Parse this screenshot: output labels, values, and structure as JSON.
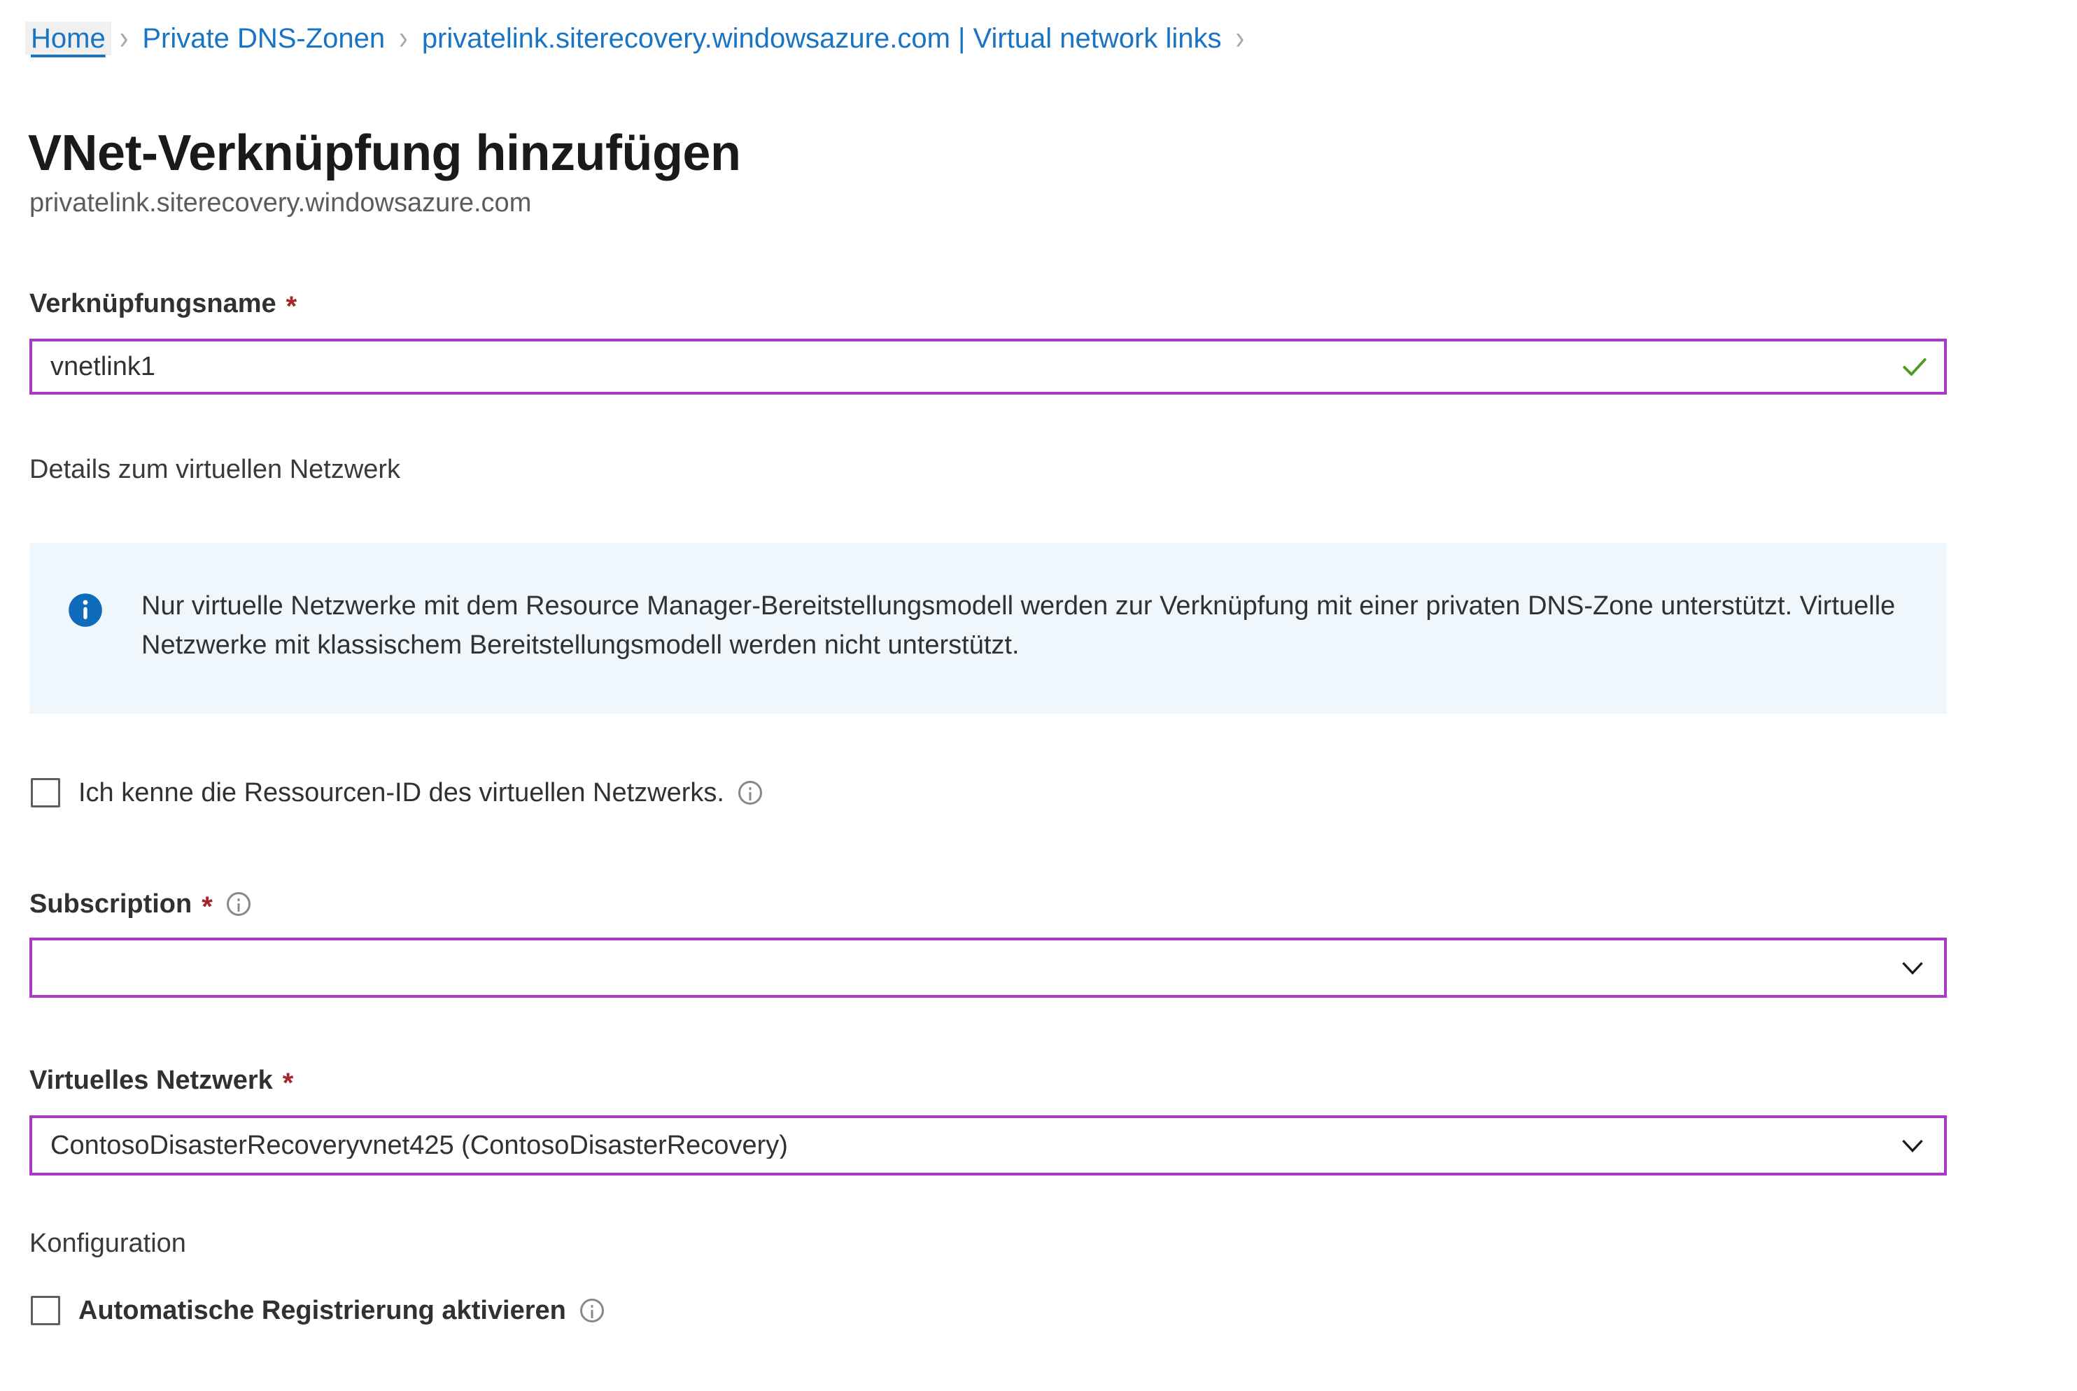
{
  "breadcrumb": {
    "separator": "›",
    "items": [
      {
        "label": "Home",
        "current": false
      },
      {
        "label": "Private DNS-Zonen",
        "current": false
      },
      {
        "label": "privatelink.siterecovery.windowsazure.com | Virtual network links",
        "current": false
      }
    ],
    "trailing_separator": "›"
  },
  "header": {
    "title": "VNet-Verknüpfung hinzufügen",
    "subtitle": "privatelink.siterecovery.windowsazure.com"
  },
  "form": {
    "link_name": {
      "label": "Verknüpfungsname",
      "required_marker": "*",
      "value": "vnetlink1",
      "placeholder": "",
      "validation_state": "valid",
      "validation_icon": "check-icon"
    },
    "vnet_details_heading": "Details zum virtuellen Netzwerk",
    "info_banner": {
      "icon": "info-filled-icon",
      "message": "Nur virtuelle Netzwerke mit dem Resource Manager-Bereitstellungsmodell werden zur Verknüpfung mit einer privaten DNS-Zone unterstützt. Virtuelle Netzwerke mit klassischem Bereitstellungsmodell werden nicht unterstützt."
    },
    "resource_id_checkbox": {
      "label": "Ich kenne die Ressourcen-ID des virtuellen Netzwerks.",
      "checked": false,
      "info_icon": "info-outline-icon"
    },
    "subscription": {
      "label": "Subscription",
      "required_marker": "*",
      "info_icon": "info-outline-icon",
      "value": "",
      "placeholder": "",
      "chevron": "chevron-down-icon"
    },
    "virtual_network": {
      "label": "Virtuelles Netzwerk",
      "required_marker": "*",
      "value": "ContosoDisasterRecoveryvnet425 (ContosoDisasterRecovery)",
      "placeholder": "",
      "chevron": "chevron-down-icon"
    },
    "configuration_heading": "Konfiguration",
    "auto_registration_checkbox": {
      "label": "Automatische Registrierung aktivieren",
      "checked": false,
      "info_icon": "info-outline-icon"
    }
  },
  "colors": {
    "link_blue": "#1a74c4",
    "field_border_purple": "#a53bc6",
    "required_red": "#a4262c",
    "banner_background": "#eff6fc",
    "banner_icon_blue": "#0f6cbd",
    "valid_green": "#4f9a22"
  }
}
